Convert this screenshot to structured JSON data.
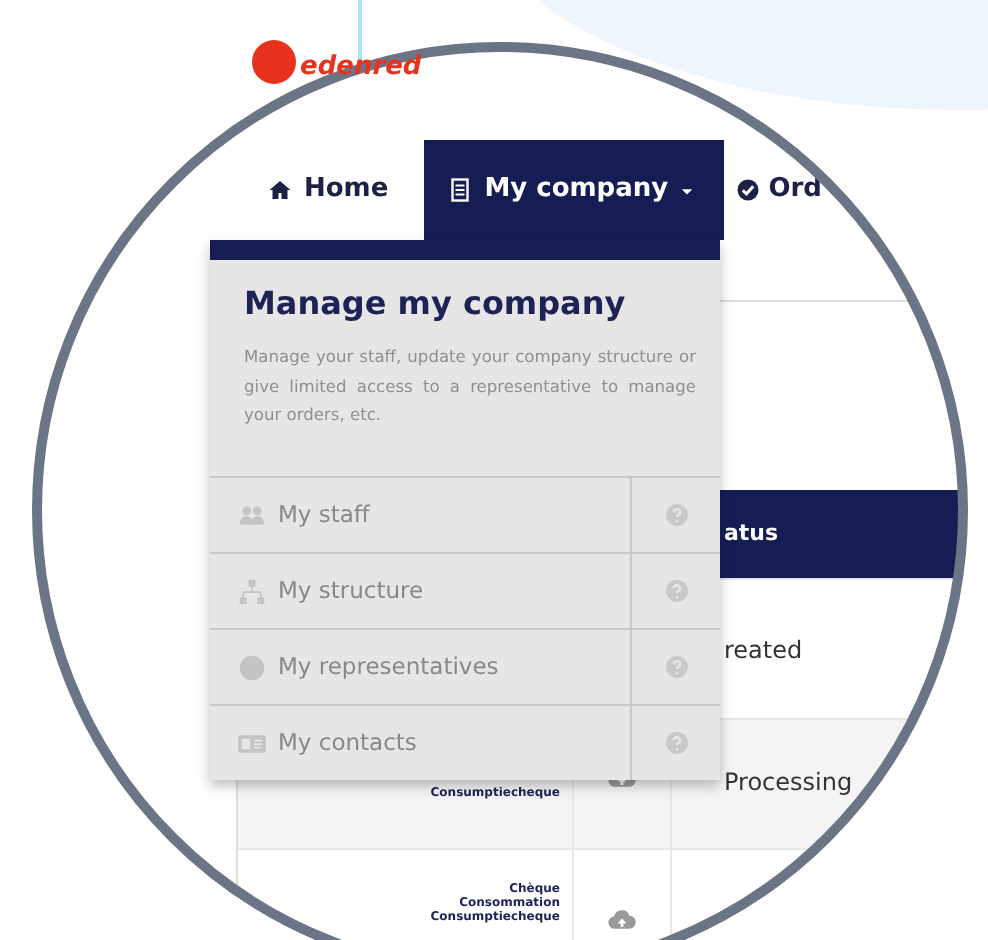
{
  "logo": {
    "text": "edenred"
  },
  "nav": {
    "items": [
      {
        "label": "Home",
        "selected": false
      },
      {
        "label": "My company",
        "selected": true
      },
      {
        "label": "Ord",
        "selected": false
      }
    ]
  },
  "dropdown": {
    "title": "Manage my company",
    "description": "Manage your staff, update your company structure or give limited access to a representative to manage your orders, etc.",
    "items": [
      {
        "label": "My staff"
      },
      {
        "label": "My structure"
      },
      {
        "label": "My representatives"
      },
      {
        "label": "My contacts"
      }
    ]
  },
  "table": {
    "header": {
      "column_3": "atus"
    },
    "rows": [
      {
        "column_1": [],
        "column_3": "reated"
      },
      {
        "column_1": [
          "Consumptiecheque"
        ],
        "column_3": "Processing"
      },
      {
        "column_1": [
          "Chèque",
          "Consommation",
          "Consumptiecheque"
        ]
      }
    ]
  }
}
